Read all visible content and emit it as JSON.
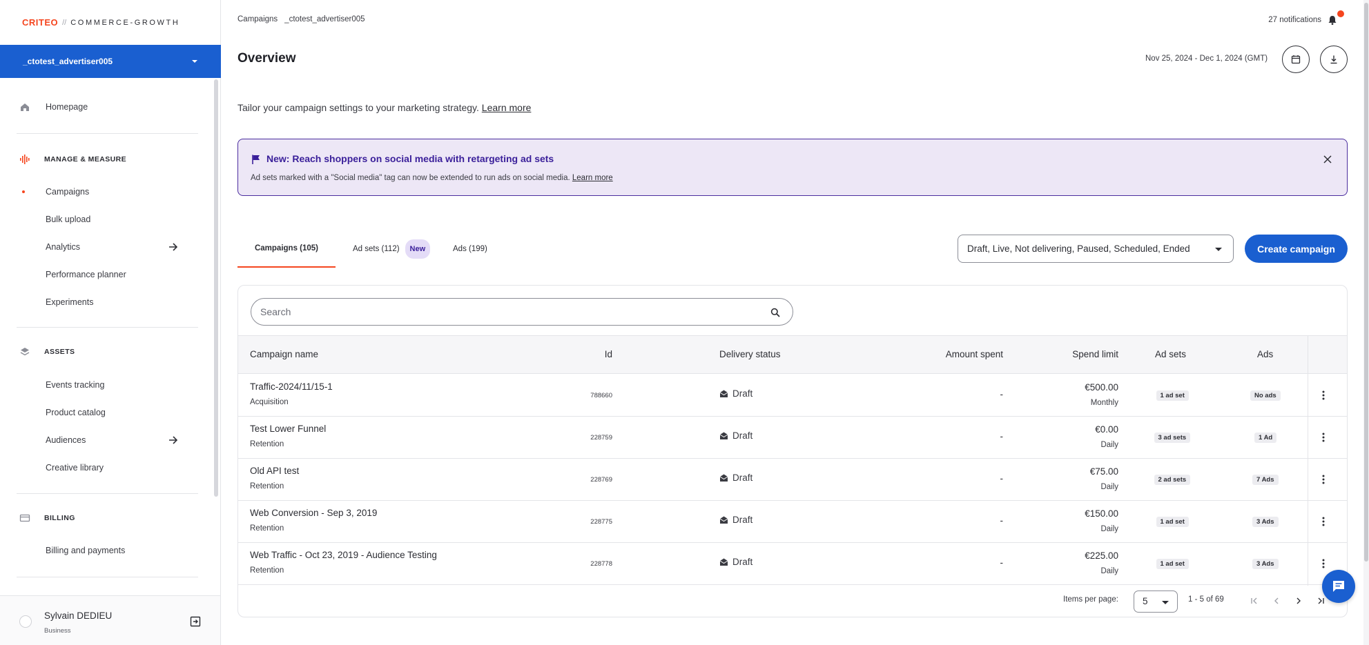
{
  "brand": {
    "logo": "CRITEO",
    "separator": "//",
    "product": "COMMERCE-GROWTH"
  },
  "account": {
    "name": "_ctotest_advertiser005"
  },
  "sidebar": {
    "homepage": "Homepage",
    "manage_section": "MANAGE & MEASURE",
    "manage_items": [
      "Campaigns",
      "Bulk upload",
      "Analytics",
      "Performance planner",
      "Experiments"
    ],
    "assets_section": "ASSETS",
    "assets_items": [
      "Events tracking",
      "Product catalog",
      "Audiences",
      "Creative library"
    ],
    "billing_section": "BILLING",
    "billing_items": [
      "Billing and payments"
    ]
  },
  "user": {
    "name": "Sylvain DEDIEU",
    "role": "Business"
  },
  "breadcrumb": [
    "Campaigns",
    "_ctotest_advertiser005"
  ],
  "notifications": {
    "label": "27 notifications"
  },
  "page": {
    "title": "Overview",
    "date_range": "Nov 25, 2024 - Dec 1, 2024 (GMT)",
    "tailor_text": "Tailor your campaign settings to your marketing strategy.",
    "learn_more": "Learn more"
  },
  "banner": {
    "title": "New: Reach shoppers on social media with retargeting ad sets",
    "text": "Ad sets marked with a \"Social media\" tag can now be extended to run ads on social media.",
    "link": "Learn more"
  },
  "tabs": [
    {
      "label": "Campaigns (105)",
      "active": true
    },
    {
      "label": "Ad sets (112)",
      "badge": "New"
    },
    {
      "label": "Ads (199)"
    }
  ],
  "filter": {
    "value": "Draft, Live, Not delivering, Paused, Scheduled, Ended"
  },
  "create_button": "Create campaign",
  "search": {
    "placeholder": "Search"
  },
  "table": {
    "headers": [
      "Campaign name",
      "Id",
      "Delivery status",
      "Amount spent",
      "Spend limit",
      "Ad sets",
      "Ads"
    ],
    "rows": [
      {
        "name": "Traffic-2024/11/15-1",
        "goal": "Acquisition",
        "id": "788660",
        "status": "Draft",
        "spent": "-",
        "limit": "€500.00",
        "period": "Monthly",
        "adsets": "1 ad set",
        "ads": "No ads"
      },
      {
        "name": "Test Lower Funnel",
        "goal": "Retention",
        "id": "228759",
        "status": "Draft",
        "spent": "-",
        "limit": "€0.00",
        "period": "Daily",
        "adsets": "3 ad sets",
        "ads": "1 Ad"
      },
      {
        "name": "Old API test",
        "goal": "Retention",
        "id": "228769",
        "status": "Draft",
        "spent": "-",
        "limit": "€75.00",
        "period": "Daily",
        "adsets": "2 ad sets",
        "ads": "7 Ads"
      },
      {
        "name": "Web Conversion - Sep 3, 2019",
        "goal": "Retention",
        "id": "228775",
        "status": "Draft",
        "spent": "-",
        "limit": "€150.00",
        "period": "Daily",
        "adsets": "1 ad set",
        "ads": "3 Ads"
      },
      {
        "name": "Web Traffic - Oct 23, 2019 - Audience Testing",
        "goal": "Retention",
        "id": "228778",
        "status": "Draft",
        "spent": "-",
        "limit": "€225.00",
        "period": "Daily",
        "adsets": "1 ad set",
        "ads": "3 Ads"
      }
    ]
  },
  "pagination": {
    "items_per_page_label": "Items per page:",
    "items_per_page": "5",
    "range": "1 - 5 of 69"
  },
  "colors": {
    "accent": "#1a5fd0",
    "brand": "#f5451e",
    "banner_bg": "#ede7f6",
    "banner_border": "#4a2c9e"
  }
}
